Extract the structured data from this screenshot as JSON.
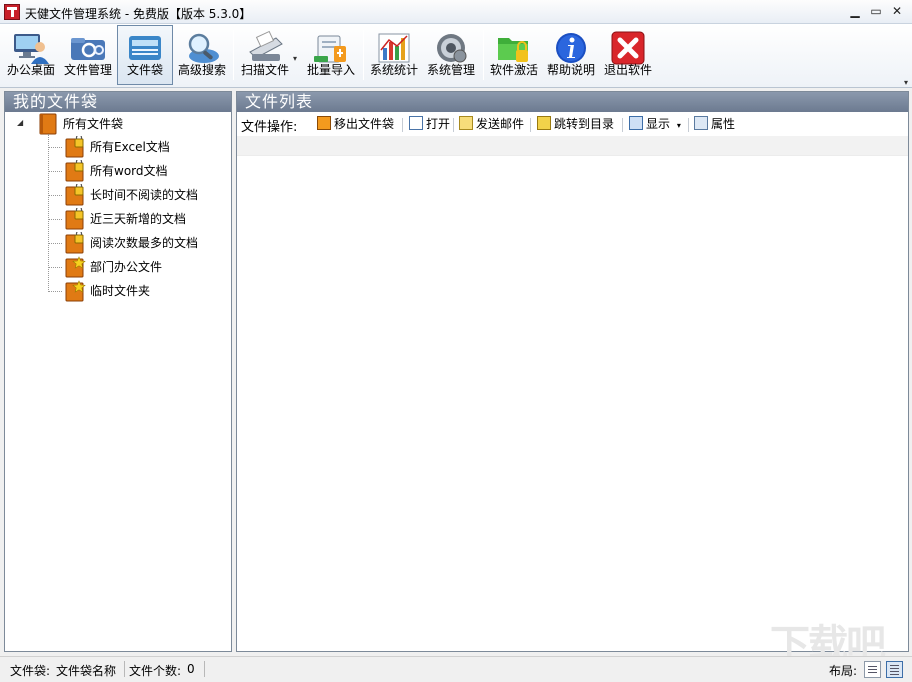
{
  "window": {
    "title": "天健文件管理系统 - 免费版【版本 5.3.0】",
    "min": "▁",
    "max": "▭",
    "close": "✕"
  },
  "toolbar": {
    "items": [
      {
        "label": "办公桌面",
        "icon": "desktop-user-icon"
      },
      {
        "label": "文件管理",
        "icon": "file-manage-icon"
      },
      {
        "label": "文件袋",
        "icon": "file-bag-icon",
        "active": true
      },
      {
        "label": "高级搜索",
        "icon": "search-icon"
      },
      {
        "label": "扫描文件",
        "icon": "scanner-icon"
      },
      {
        "label": "批量导入",
        "icon": "batch-import-icon"
      },
      {
        "label": "系统统计",
        "icon": "chart-icon"
      },
      {
        "label": "系统管理",
        "icon": "gear-icon"
      },
      {
        "label": "软件激活",
        "icon": "lock-folder-icon"
      },
      {
        "label": "帮助说明",
        "icon": "info-icon"
      },
      {
        "label": "退出软件",
        "icon": "exit-icon"
      }
    ],
    "dropdown_arrow": "▾",
    "more_arrow": "▾"
  },
  "left_panel": {
    "title": "我的文件袋",
    "expander": "◢",
    "tree": {
      "root": "所有文件袋",
      "children": [
        {
          "label": "所有Excel文档",
          "icon": "locked-bag-icon"
        },
        {
          "label": "所有word文档",
          "icon": "locked-bag-icon"
        },
        {
          "label": "长时间不阅读的文档",
          "icon": "locked-bag-icon"
        },
        {
          "label": "近三天新增的文档",
          "icon": "locked-bag-icon"
        },
        {
          "label": "阅读次数最多的文档",
          "icon": "locked-bag-icon"
        },
        {
          "label": "部门办公文件",
          "icon": "star-bag-icon"
        },
        {
          "label": "临时文件夹",
          "icon": "star-bag-icon"
        }
      ]
    }
  },
  "right_panel": {
    "title": "文件列表",
    "ops_label": "文件操作:",
    "ops": [
      {
        "label": "移出文件袋",
        "icon": "remove-bag-icon"
      },
      {
        "label": "打开",
        "icon": "open-icon"
      },
      {
        "label": "发送邮件",
        "icon": "mail-icon"
      },
      {
        "label": "跳转到目录",
        "icon": "folder-jump-icon"
      },
      {
        "label": "显示",
        "icon": "display-icon",
        "dropdown": "▾"
      },
      {
        "label": "属性",
        "icon": "properties-icon"
      }
    ]
  },
  "status": {
    "bag": "文件袋:",
    "bag_name": "文件袋名称",
    "count_label": "文件个数:",
    "count_value": "0",
    "layout_label": "布局:"
  },
  "colors": {
    "panel_header": "#7a889c",
    "active_border": "#6f8aa8",
    "exit_red": "#d9262b",
    "info_blue": "#1b4fc2",
    "folder_orange": "#e07a14"
  },
  "watermark": "下载吧"
}
